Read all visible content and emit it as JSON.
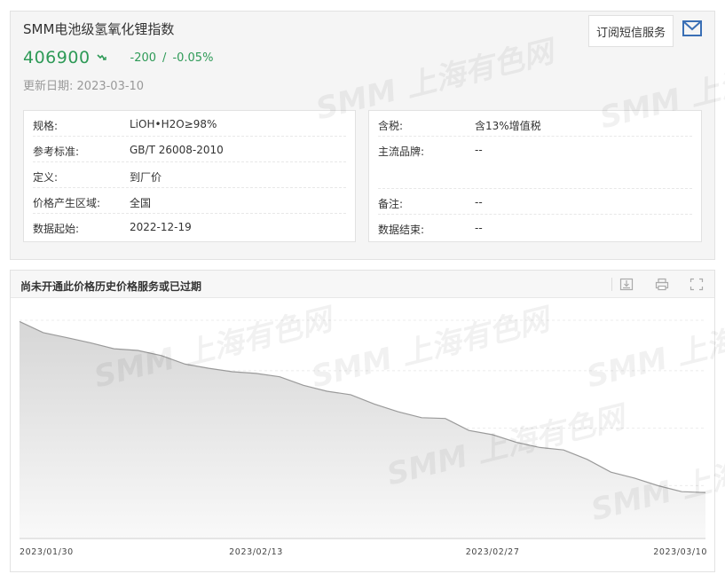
{
  "product": {
    "title": "SMM电池级氢氧化锂指数",
    "price": "406900",
    "change_abs": "-200",
    "change_sep": "/",
    "change_pct": "-0.05%",
    "update_label": "更新日期:",
    "update_date": "2023-03-10"
  },
  "actions": {
    "subscribe_label": "订阅短信服务"
  },
  "specs_left": [
    {
      "label": "规格:",
      "value": "LiOH•H2O≥98%"
    },
    {
      "label": "参考标准:",
      "value": "GB/T 26008-2010"
    },
    {
      "label": "定义:",
      "value": "到厂价"
    },
    {
      "label": "价格产生区域:",
      "value": "全国"
    },
    {
      "label": "数据起始:",
      "value": "2022-12-19"
    }
  ],
  "specs_right": [
    {
      "label": "含税:",
      "value": "含13%增值税"
    },
    {
      "label": "主流品牌:",
      "value": "--"
    },
    {
      "label": "",
      "value": ""
    },
    {
      "label": "备注:",
      "value": "--"
    },
    {
      "label": "数据结束:",
      "value": "--"
    }
  ],
  "chart_header": {
    "title": "尚未开通此价格历史价格服务或已过期"
  },
  "watermark": {
    "text": "SMM 上海有色网"
  },
  "colors": {
    "accent_green": "#2e9a57",
    "mail_blue": "#3a6fb5",
    "line": "#9a9a9a"
  },
  "chart_data": {
    "type": "area",
    "title": "",
    "xlabel": "",
    "ylabel": "",
    "x_ticks": [
      "2023/01/30",
      "2023/02/13",
      "2023/02/27",
      "2023/03/10"
    ],
    "x": [
      "2023/01/30",
      "2023/01/31",
      "2023/02/01",
      "2023/02/02",
      "2023/02/03",
      "2023/02/06",
      "2023/02/07",
      "2023/02/08",
      "2023/02/09",
      "2023/02/10",
      "2023/02/13",
      "2023/02/14",
      "2023/02/15",
      "2023/02/16",
      "2023/02/17",
      "2023/02/20",
      "2023/02/21",
      "2023/02/22",
      "2023/02/23",
      "2023/02/24",
      "2023/02/27",
      "2023/02/28",
      "2023/03/01",
      "2023/03/02",
      "2023/03/03",
      "2023/03/06",
      "2023/03/07",
      "2023/03/08",
      "2023/03/09",
      "2023/03/10"
    ],
    "y_axis_labels_visible": false,
    "grid": "horizontal dashed",
    "series": [
      {
        "values": [
          555,
          542,
          536,
          530,
          523,
          521,
          515,
          505,
          500,
          496,
          494,
          490,
          480,
          473,
          469,
          458,
          449,
          442,
          441,
          427,
          422,
          413,
          407,
          404,
          393,
          378,
          371,
          362,
          355,
          354
        ]
      }
    ],
    "ylim": [
      300,
      570
    ]
  }
}
